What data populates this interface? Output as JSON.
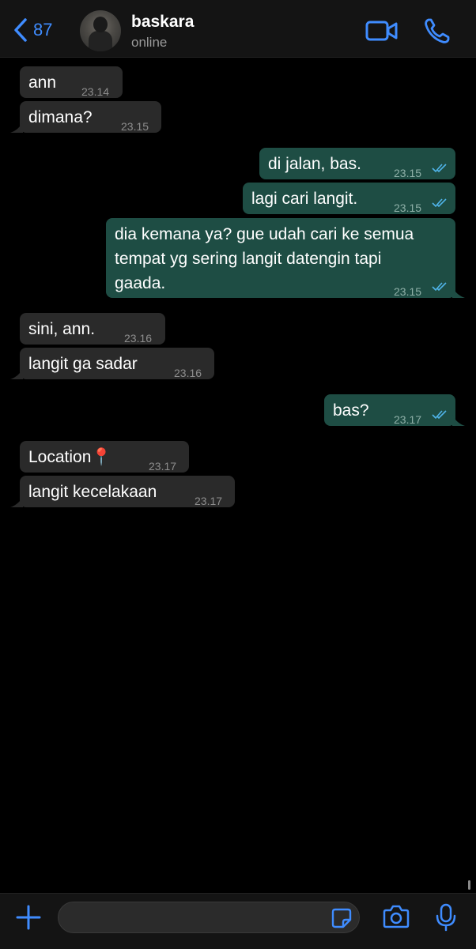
{
  "header": {
    "back_count": "87",
    "contact_name": "baskara",
    "contact_status": "online"
  },
  "messages": [
    {
      "dir": "in",
      "text": "ann",
      "time": "23.14"
    },
    {
      "dir": "in",
      "text": "dimana?",
      "time": "23.15"
    },
    {
      "dir": "out",
      "text": "di jalan, bas.",
      "time": "23.15"
    },
    {
      "dir": "out",
      "text": "lagi cari langit.",
      "time": "23.15"
    },
    {
      "dir": "out",
      "text": "dia kemana ya? gue udah cari ke semua\ntempat yg sering langit datengin tapi\ngaada.",
      "time": "23.15"
    },
    {
      "dir": "in",
      "text": "sini, ann.",
      "time": "23.16"
    },
    {
      "dir": "in",
      "text": "langit ga sadar",
      "time": "23.16"
    },
    {
      "dir": "out",
      "text": "bas?",
      "time": "23.17"
    },
    {
      "dir": "in",
      "text": "Location📍",
      "time": "23.17"
    },
    {
      "dir": "in",
      "text": "langit kecelakaan",
      "time": "23.17"
    }
  ],
  "input": {
    "placeholder": ""
  },
  "colors": {
    "accent": "#3f8cff",
    "incoming_bubble": "#2a2a2a",
    "outgoing_bubble": "#1e4d44",
    "read_ticks": "#4fb3e8"
  },
  "icons": [
    "chevron-left-icon",
    "video-icon",
    "phone-icon",
    "plus-icon",
    "sticker-icon",
    "camera-icon",
    "microphone-icon"
  ]
}
